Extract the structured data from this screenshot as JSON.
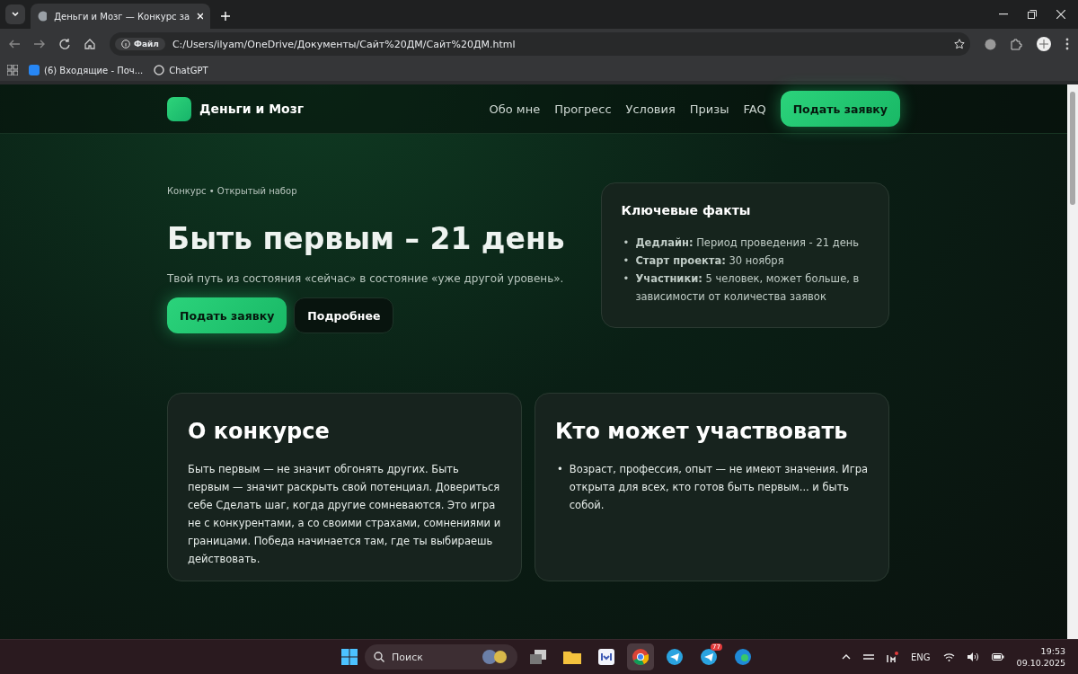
{
  "browser": {
    "tab_title": "Деньги и Мозг — Конкурс за",
    "url_badge": "Файл",
    "url": "C:/Users/ilyam/OneDrive/Документы/Сайт%20ДМ/Сайт%20ДМ.html",
    "bookmarks": [
      "(6) Входящие - Поч...",
      "ChatGPT"
    ]
  },
  "site": {
    "brand": "Деньги и Мозг",
    "nav": [
      "Обо мне",
      "Прогресс",
      "Условия",
      "Призы",
      "FAQ"
    ],
    "nav_cta": "Подать заявку",
    "eyebrow": "Конкурс • Открытый набор",
    "title": "Быть первым – 21 день",
    "subtitle": "Твой путь из состояния «сейчас» в состояние «уже другой уровень».",
    "buttons": [
      {
        "label": "Подать заявку",
        "kind": "primary"
      },
      {
        "label": "Подробнее",
        "kind": "ghost"
      }
    ],
    "facts": {
      "title": "Ключевые факты",
      "bullet": "•",
      "items": [
        "**Дедлайн:** Период проведения - 21 день",
        "**Старт проекта:** 30 ноября",
        "**Участники:** 5 человек, может больше, в зависимости от количества заявок"
      ]
    },
    "cards": [
      {
        "title": "О конкурсе",
        "kind": "text",
        "text": "Быть первым — не значит обгонять других. Быть первым — значит раскрыть свой потенциал. Довериться себе Сделать шаг, когда другие сомневаются. Это игра не с конкурентами, а со своими страхами, сомнениями и границами. Победа начинается там, где ты выбираешь действовать."
      },
      {
        "title": "Кто может участвовать",
        "kind": "list",
        "bullet": "•",
        "items": [
          "Возраст, профессия, опыт — не имеют значения. Игра открыта для всех, кто готов быть первым... и быть собой."
        ]
      }
    ]
  },
  "taskbar": {
    "search": "Поиск",
    "apps": [
      {
        "kind": "taskview",
        "selected": false
      },
      {
        "kind": "folder",
        "selected": false
      },
      {
        "kind": "mail",
        "selected": false
      },
      {
        "kind": "chrome",
        "selected": true
      },
      {
        "kind": "telegram",
        "selected": false
      },
      {
        "kind": "telegram-badge",
        "selected": false,
        "badge": "77"
      },
      {
        "kind": "edge",
        "selected": false
      }
    ],
    "language": "ENG",
    "time": "19:53",
    "date": "09.10.2025"
  }
}
